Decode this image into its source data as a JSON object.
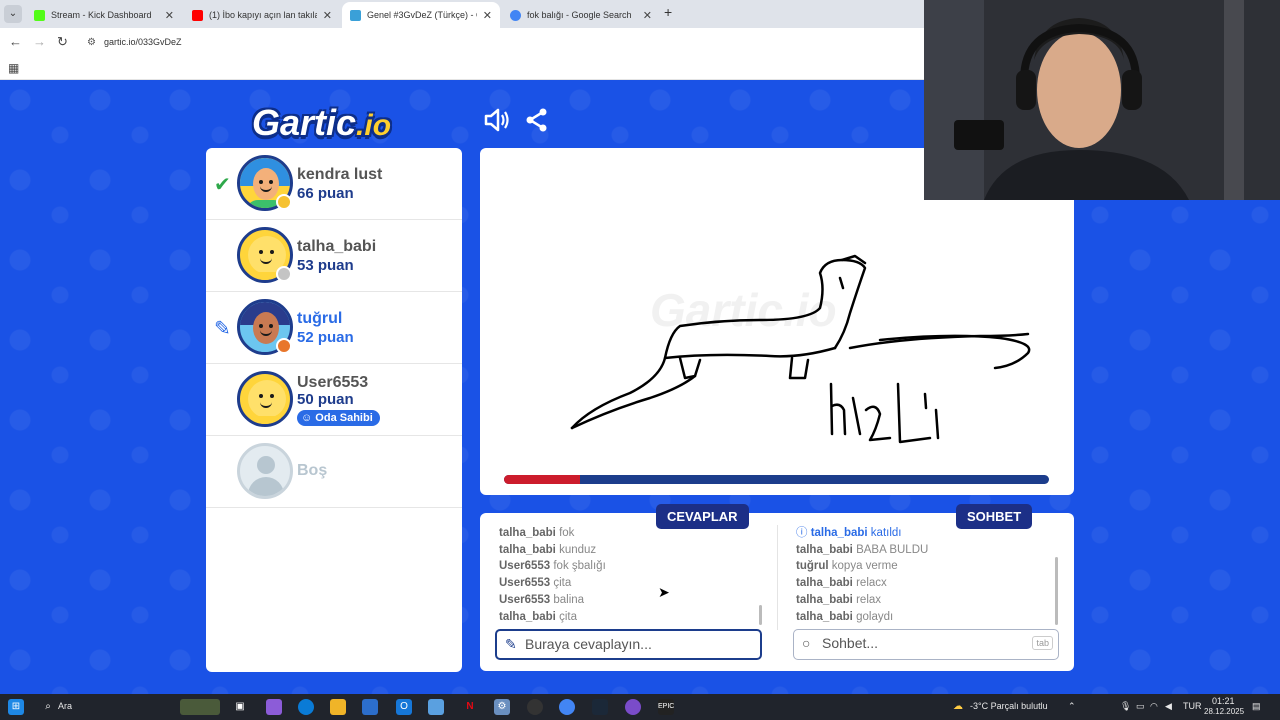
{
  "browser": {
    "tabs": [
      {
        "title": "Stream - Kick Dashboard",
        "favcolor": "#53fc18"
      },
      {
        "title": "(1) İbo kapıyı açın lan takılacaz",
        "favcolor": "#ff0000"
      },
      {
        "title": "Genel #3GvDeZ (Türkçe) - Gartic",
        "favcolor": "#3aa0d8"
      },
      {
        "title": "fok balığı - Google Search",
        "favcolor": "#4285f4"
      }
    ],
    "url": "gartic.io/033GvDeZ"
  },
  "game": {
    "logo_main": "Gartic",
    "logo_io": ".io",
    "players": [
      {
        "name": "kendra lust",
        "points": "66 puan",
        "status": "guessed"
      },
      {
        "name": "talha_babi",
        "points": "53 puan",
        "status": ""
      },
      {
        "name": "tuğrul",
        "points": "52 puan",
        "status": "drawing"
      },
      {
        "name": "User6553",
        "points": "50 puan",
        "status": "owner",
        "badge": "Oda Sahibi"
      }
    ],
    "empty_slot": "Boş",
    "watermark": "Gartic.io",
    "timer_fraction": 0.14,
    "drawing_text": "hızlı",
    "answers": {
      "title": "CEVAPLAR",
      "messages": [
        {
          "user": "talha_babi",
          "text": "fok"
        },
        {
          "user": "talha_babi",
          "text": "kunduz"
        },
        {
          "user": "User6553",
          "text": "fok şbalığı"
        },
        {
          "user": "User6553",
          "text": "çita"
        },
        {
          "user": "User6553",
          "text": "balina"
        },
        {
          "user": "talha_babi",
          "text": "çita"
        }
      ],
      "placeholder": "Buraya cevaplayın..."
    },
    "chat": {
      "title": "SOHBET",
      "messages": [
        {
          "user": "talha_babi",
          "text": "katıldı",
          "join": true
        },
        {
          "user": "talha_babi",
          "text": "BABA BULDU"
        },
        {
          "user": "tuğrul",
          "text": "kopya verme"
        },
        {
          "user": "talha_babi",
          "text": "relacx"
        },
        {
          "user": "talha_babi",
          "text": "relax"
        },
        {
          "user": "talha_babi",
          "text": "golaydı"
        }
      ],
      "placeholder": "Sohbet...",
      "tab_hint": "tab"
    }
  },
  "taskbar": {
    "search": "Ara",
    "weather": "-3°C  Parçalı bulutlu",
    "lang": "TUR",
    "time": "01:21",
    "date": "28.12.2025"
  }
}
